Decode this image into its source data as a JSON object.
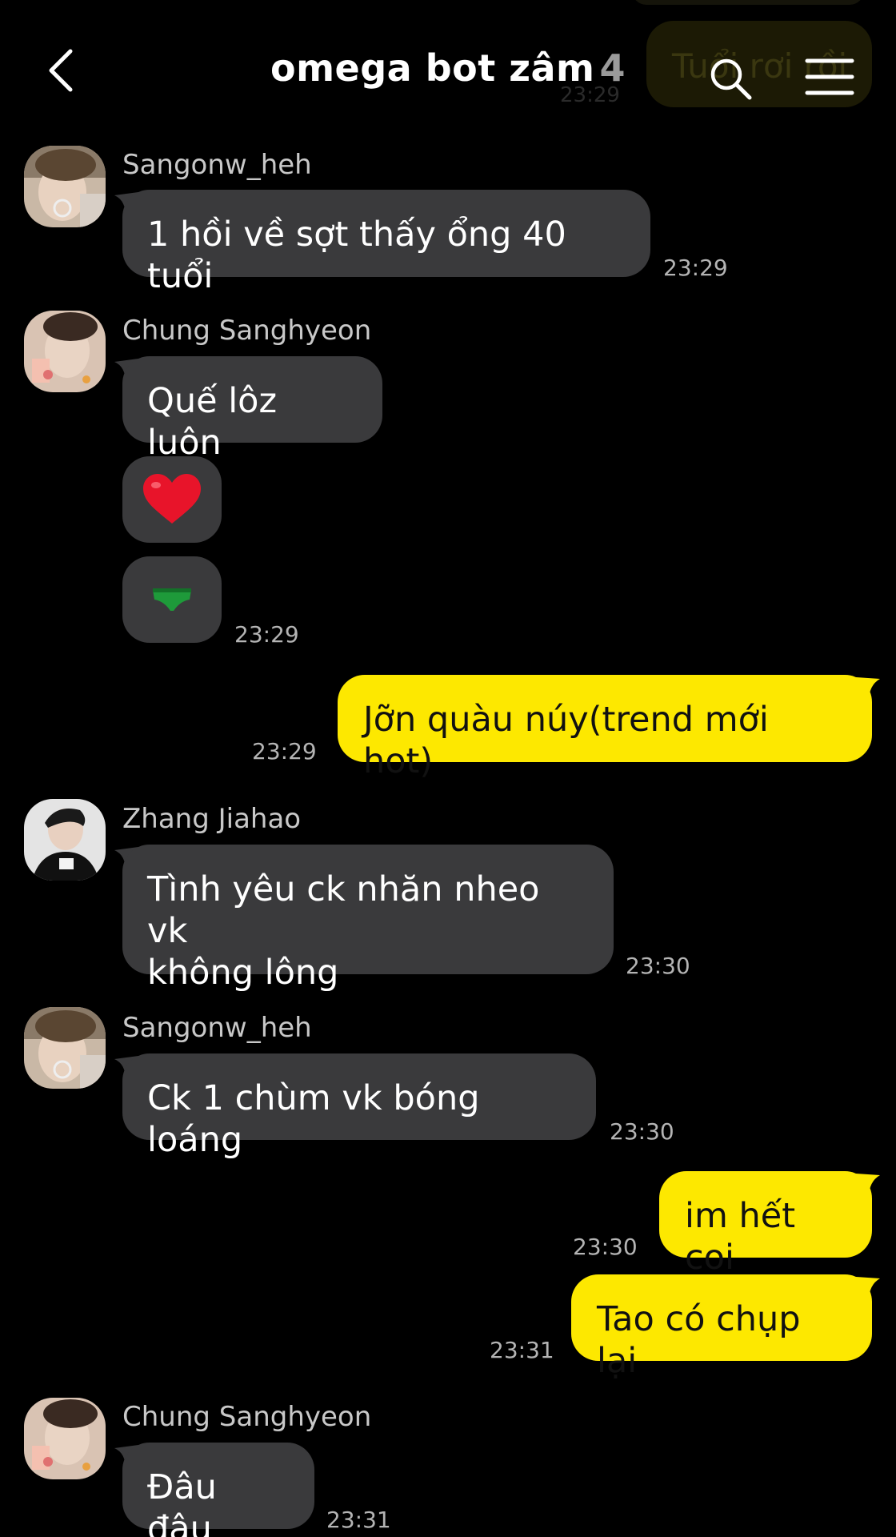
{
  "header": {
    "title": "omega bot zâm",
    "member_count": "4",
    "background_bubble_text": "Tuổi rơi rồi",
    "background_time": "23:29"
  },
  "messages": [
    {
      "sender": "Sangonw_heh",
      "text": "1 hồi về sợt thấy ổng 40 tuổi",
      "time": "23:29"
    },
    {
      "sender": "Chung Sanghyeon",
      "text": "Quế lôz luôn",
      "emoji1": "❤️",
      "emoji2": "green underwear sticker",
      "time": "23:29"
    },
    {
      "sender": "me",
      "text": "Jỡn quàu núy(trend mới hot)",
      "time": "23:29"
    },
    {
      "sender": "Zhang Jiahao",
      "text_line1": "Tình yêu ck nhăn nheo vk",
      "text_line2": "không lông",
      "time": "23:30"
    },
    {
      "sender": "Sangonw_heh",
      "text": "Ck 1 chùm vk bóng loáng",
      "time": "23:30"
    },
    {
      "sender": "me",
      "text": "im hết coi",
      "time": "23:30"
    },
    {
      "sender": "me",
      "text": "Tao có chụp lại",
      "time": "23:31"
    },
    {
      "sender": "Chung Sanghyeon",
      "text": "Đâu đâu",
      "time": "23:31"
    }
  ],
  "colors": {
    "background": "#000000",
    "incoming_bubble": "#3a3a3c",
    "outgoing_bubble": "#fde800",
    "timestamp": "#b4b4b4",
    "sender_name": "#c8c8c8"
  },
  "icons": {
    "back": "chevron-left-icon",
    "search": "search-icon",
    "menu": "hamburger-menu-icon",
    "heart": "red-heart-emoji"
  }
}
